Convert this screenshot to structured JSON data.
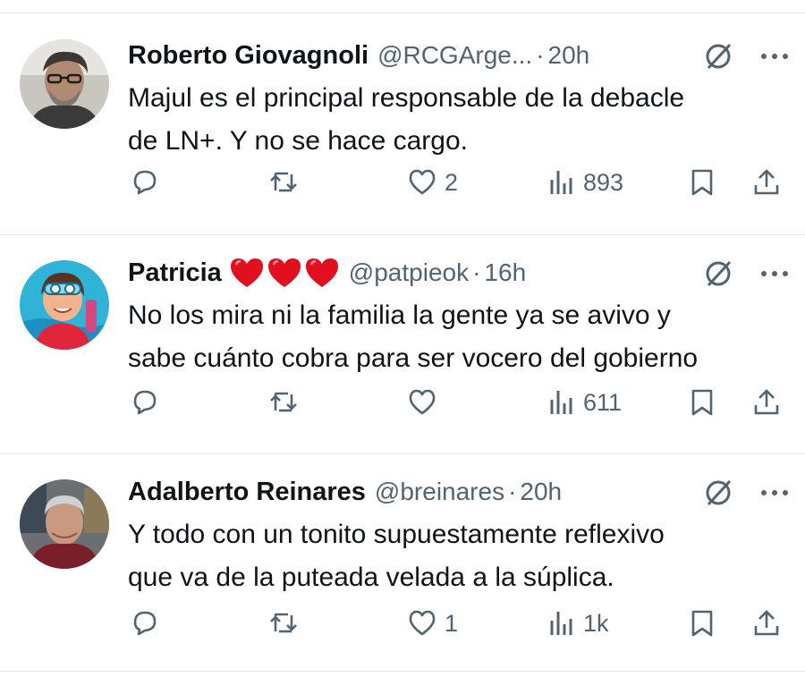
{
  "tweets": [
    {
      "name": "Roberto Giovagnoli",
      "handle": "@RCGArge...",
      "dot": "·",
      "time": "20h",
      "text_lines": [
        "Majul es el principal responsable de la debacle",
        "de LN+. Y no se hace cargo."
      ],
      "hearts": [],
      "likes": "2",
      "views": "893",
      "avatar": "man-glasses-avatar"
    },
    {
      "name": "Patricia",
      "handle": "@patpieok",
      "dot": "·",
      "time": "16h",
      "text_lines": [
        "No los mira ni la familia la gente ya se avivo y",
        "sabe cuánto cobra para ser vocero del gobierno"
      ],
      "hearts": [
        "red-heart-emoji",
        "red-heart-emoji",
        "red-heart-emoji"
      ],
      "likes": "",
      "views": "611",
      "avatar": "cartoon-swimmer-avatar"
    },
    {
      "name": "Adalberto Reinares",
      "handle": "@breinares",
      "dot": "·",
      "time": "20h",
      "text_lines": [
        "Y todo con un tonito supuestamente reflexivo",
        "que va de la puteada velada a la súplica."
      ],
      "hearts": [],
      "likes": "1",
      "views": "1k",
      "avatar": "gray-haired-man-avatar"
    }
  ],
  "colors": {
    "text": "#0f1419",
    "secondary": "#536471",
    "divider": "#e7e9ea",
    "heart": "#e0101f"
  },
  "icons": [
    "reply-icon",
    "retweet-icon",
    "like-icon",
    "views-icon",
    "bookmark-icon",
    "share-icon",
    "grok-icon",
    "more-icon"
  ]
}
